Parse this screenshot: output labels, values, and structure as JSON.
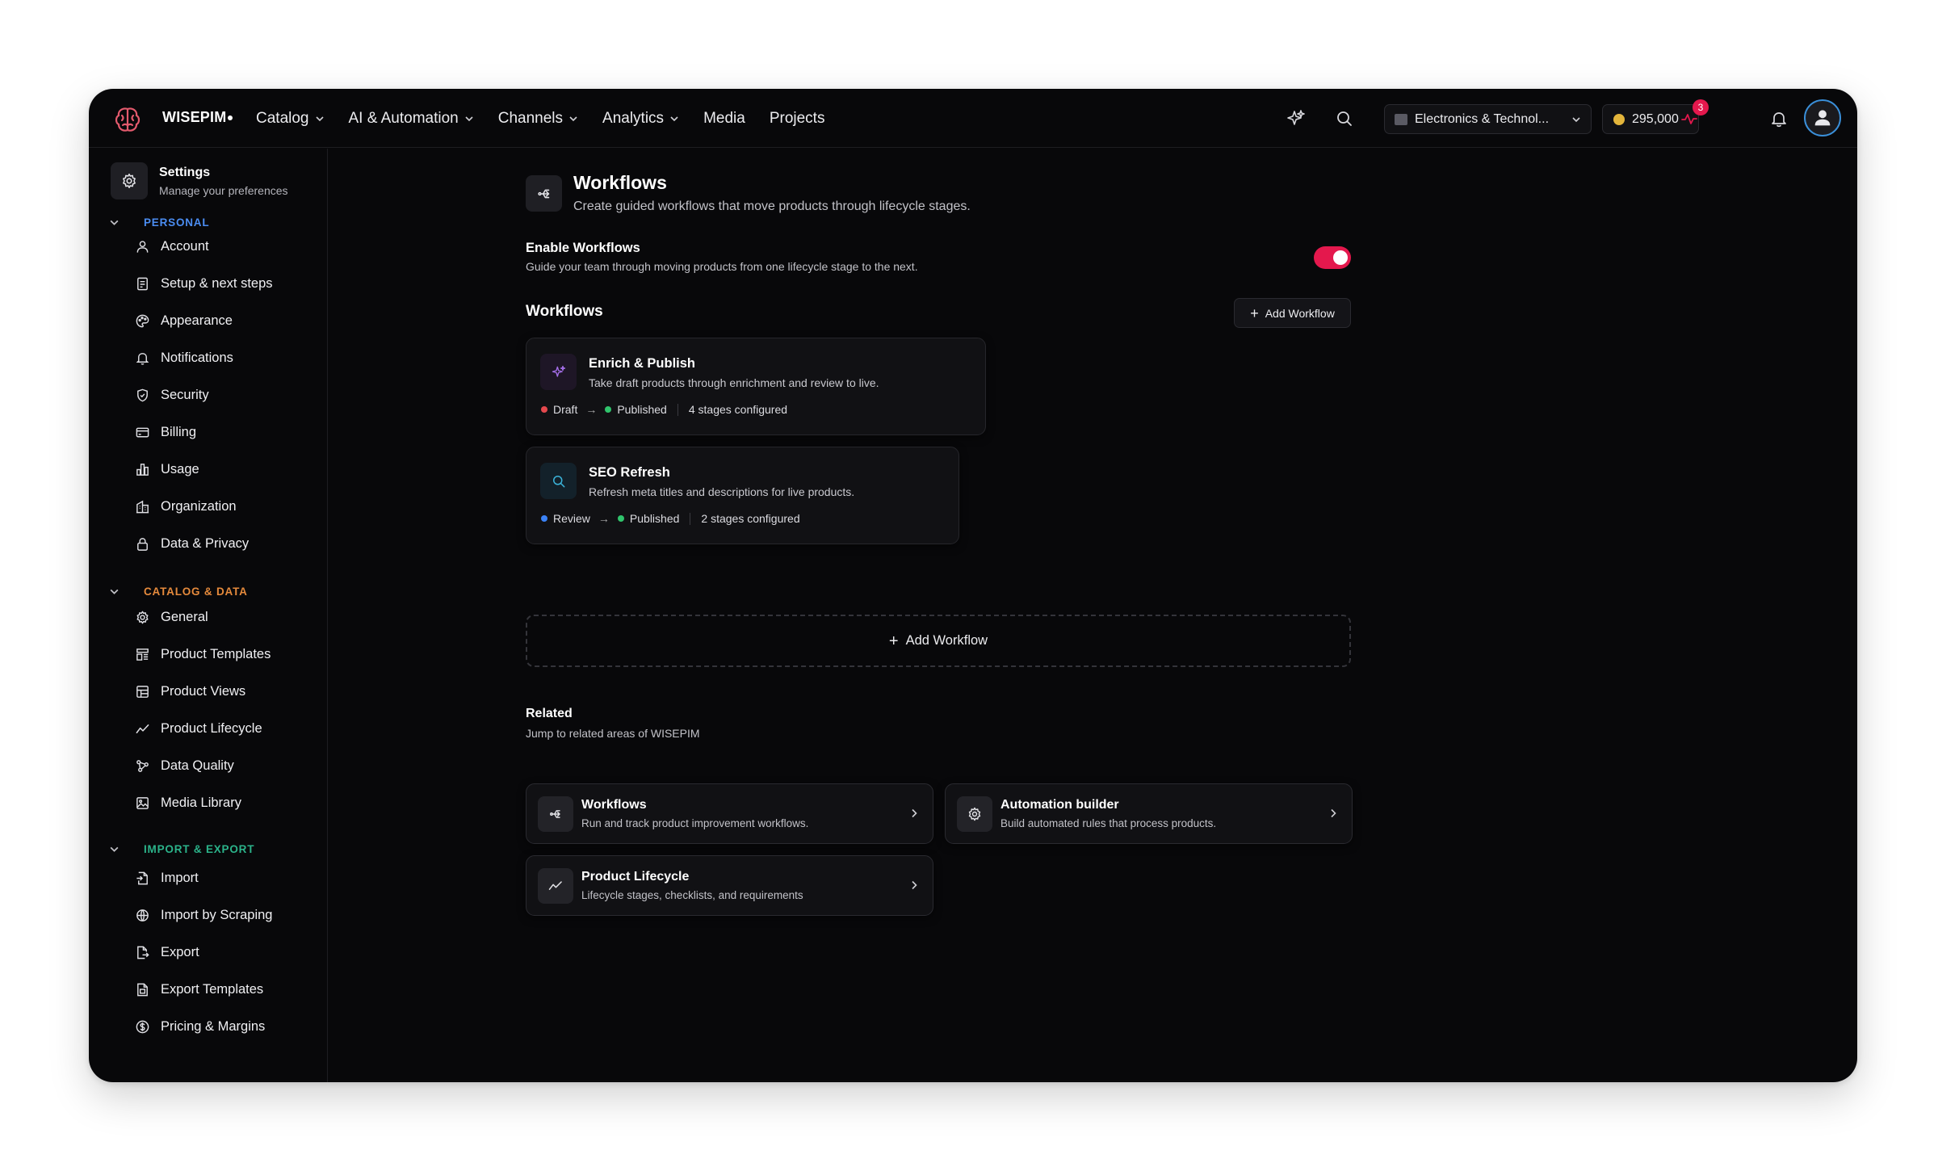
{
  "app": {
    "brand": "WISEPIM"
  },
  "nav": {
    "items": [
      {
        "label": "Catalog",
        "dropdown": true
      },
      {
        "label": "AI & Automation",
        "dropdown": true
      },
      {
        "label": "Channels",
        "dropdown": true
      },
      {
        "label": "Analytics",
        "dropdown": true
      },
      {
        "label": "Media",
        "dropdown": false
      },
      {
        "label": "Projects",
        "dropdown": false
      }
    ],
    "workspace": "Electronics & Technol...",
    "credits": "295,000",
    "alerts_count": "3",
    "icons": [
      "sparkles-icon",
      "search-icon",
      "activity-icon",
      "bell-icon",
      "user-icon"
    ]
  },
  "sidebar": {
    "title": "Settings",
    "subtitle": "Manage your preferences",
    "sections": [
      {
        "label": "PERSONAL",
        "color": "#4b8df2",
        "items": [
          {
            "label": "Account",
            "icon": "user-icon"
          },
          {
            "label": "Setup & next steps",
            "icon": "checklist-icon"
          },
          {
            "label": "Appearance",
            "icon": "palette-icon"
          },
          {
            "label": "Notifications",
            "icon": "bell-icon"
          },
          {
            "label": "Security",
            "icon": "shield-icon"
          },
          {
            "label": "Billing",
            "icon": "credit-card-icon"
          },
          {
            "label": "Usage",
            "icon": "bar-chart-icon"
          },
          {
            "label": "Organization",
            "icon": "building-icon"
          },
          {
            "label": "Data & Privacy",
            "icon": "lock-icon"
          }
        ]
      },
      {
        "label": "CATALOG & DATA",
        "color": "#e58a3c",
        "items": [
          {
            "label": "General",
            "icon": "gear-icon"
          },
          {
            "label": "Product Templates",
            "icon": "template-icon"
          },
          {
            "label": "Product Views",
            "icon": "layout-icon"
          },
          {
            "label": "Product Lifecycle",
            "icon": "trend-icon"
          },
          {
            "label": "Data Quality",
            "icon": "network-icon"
          },
          {
            "label": "Media Library",
            "icon": "image-icon"
          }
        ]
      },
      {
        "label": "IMPORT & EXPORT",
        "color": "#2bb38a",
        "items": [
          {
            "label": "Import",
            "icon": "file-import-icon"
          },
          {
            "label": "Import by Scraping",
            "icon": "globe-icon"
          },
          {
            "label": "Export",
            "icon": "file-export-icon"
          },
          {
            "label": "Export Templates",
            "icon": "file-template-icon"
          },
          {
            "label": "Pricing & Margins",
            "icon": "dollar-icon"
          }
        ]
      }
    ]
  },
  "main": {
    "title": "Workflows",
    "subtitle": "Create guided workflows that move products through lifecycle stages.",
    "enable": {
      "title": "Enable Workflows",
      "description": "Guide your team through moving products from one lifecycle stage to the next.",
      "on": true
    },
    "workflows_heading": "Workflows",
    "add_label": "Add Workflow",
    "workflows": [
      {
        "title": "Enrich & Publish",
        "description": "Take draft products through enrichment and review to live.",
        "from": {
          "label": "Draft",
          "color": "#e5484d"
        },
        "to": {
          "label": "Published",
          "color": "#30c46c"
        },
        "stages": "4 stages configured",
        "icon": "sparkle-icon"
      },
      {
        "title": "SEO Refresh",
        "description": "Refresh meta titles and descriptions for live products.",
        "from": {
          "label": "Review",
          "color": "#3b82f6"
        },
        "to": {
          "label": "Published",
          "color": "#30c46c"
        },
        "stages": "2 stages configured",
        "icon": "search-icon"
      }
    ],
    "add_dashed_label": "Add Workflow",
    "related": {
      "title": "Related",
      "subtitle": "Jump to related areas of WISEPIM",
      "items": [
        {
          "title": "Workflows",
          "description": "Run and track product improvement workflows.",
          "icon": "workflow-icon"
        },
        {
          "title": "Automation builder",
          "description": "Build automated rules that process products.",
          "icon": "gear-icon"
        },
        {
          "title": "Product Lifecycle",
          "description": "Lifecycle stages, checklists, and requirements",
          "icon": "trend-icon"
        }
      ]
    }
  }
}
